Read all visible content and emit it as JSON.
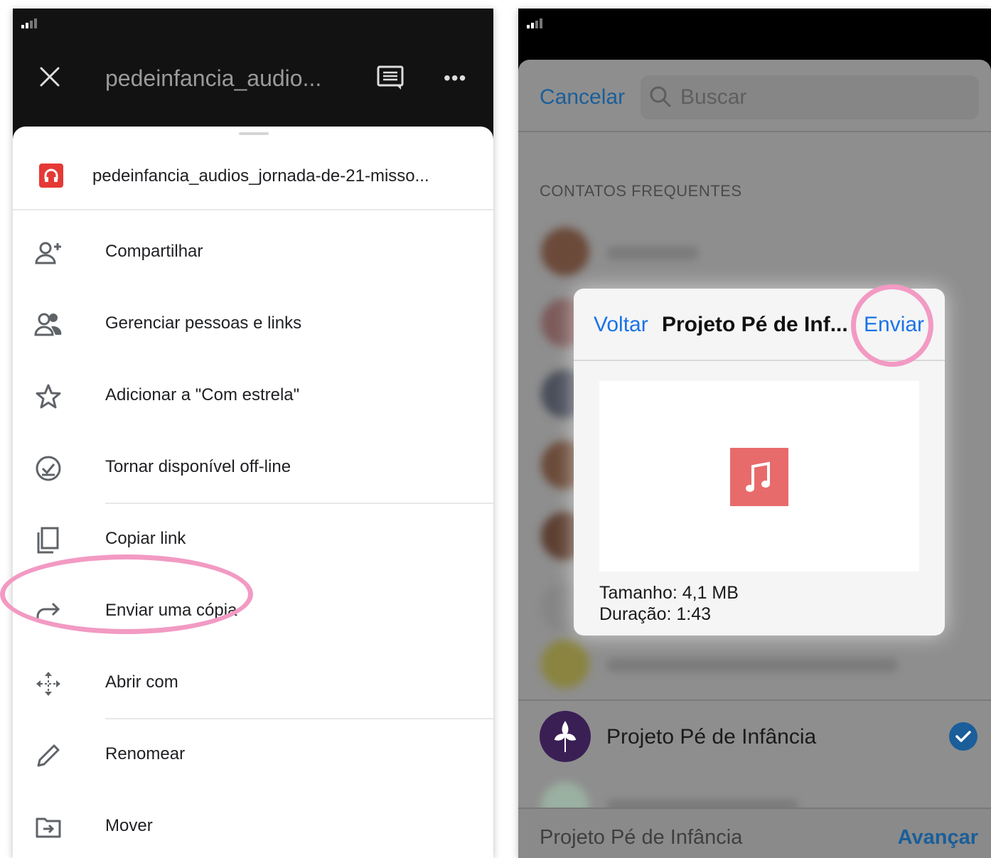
{
  "left": {
    "header": {
      "title": "pedeinfancia_audio...",
      "icons": [
        "close-icon",
        "comment-icon",
        "more-icon"
      ]
    },
    "file": {
      "name": "pedeinfancia_audios_jornada-de-21-misso...",
      "icon": "audio-file-icon",
      "icon_color": "#e53935"
    },
    "menu": [
      {
        "label": "Compartilhar",
        "icon": "add-person-icon"
      },
      {
        "label": "Gerenciar pessoas e links",
        "icon": "people-icon"
      },
      {
        "label": "Adicionar a \"Com estrela\"",
        "icon": "star-icon"
      },
      {
        "label": "Tornar disponível off-line",
        "icon": "offline-check-icon"
      },
      {
        "label": "Copiar link",
        "icon": "copy-icon"
      },
      {
        "label": "Enviar uma cópia",
        "icon": "forward-arrow-icon"
      },
      {
        "label": "Abrir com",
        "icon": "move-arrows-icon"
      },
      {
        "label": "Renomear",
        "icon": "pencil-icon"
      },
      {
        "label": "Mover",
        "icon": "folder-move-icon"
      }
    ]
  },
  "right": {
    "search": {
      "cancel_label": "Cancelar",
      "placeholder": "Buscar"
    },
    "section_header": "CONTATOS FREQUENTES",
    "dialog": {
      "back_label": "Voltar",
      "title": "Projeto Pé de Inf...",
      "send_label": "Enviar",
      "size_text": "Tamanho: 4,1 MB",
      "duration_text": "Duração: 1:43"
    },
    "selected_contact": {
      "name": "Projeto Pé de Infância",
      "selected": true
    },
    "bottom_bar": {
      "recipient": "Projeto Pé de Infância",
      "advance_label": "Avançar"
    }
  },
  "colors": {
    "highlight_circle": "#f29ac3",
    "ios_blue": "#1a73e8",
    "avatar_purple": "#3a1f55"
  }
}
